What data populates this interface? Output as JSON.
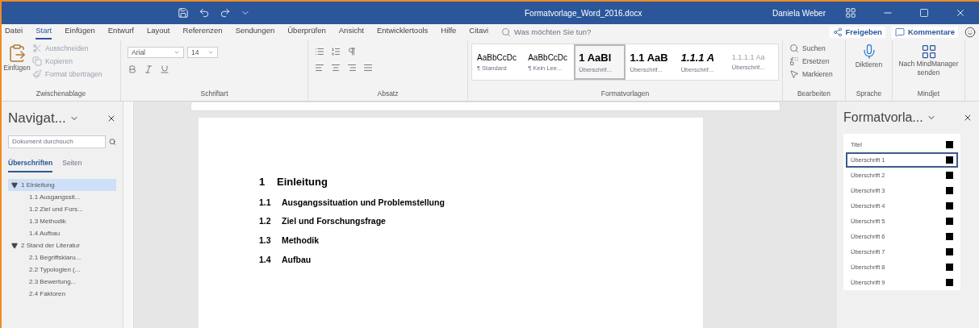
{
  "title_bar": {
    "document_title": "Formatvorlage_Word_2016.docx",
    "user_name": "Daniela Weber"
  },
  "ribbon": {
    "tabs": [
      {
        "label": "Datei",
        "selected": false
      },
      {
        "label": "Start",
        "selected": true
      },
      {
        "label": "Einfügen",
        "selected": false
      },
      {
        "label": "Entwurf",
        "selected": false
      },
      {
        "label": "Layout",
        "selected": false
      },
      {
        "label": "Referenzen",
        "selected": false
      },
      {
        "label": "Sendungen",
        "selected": false
      },
      {
        "label": "Überprüfen",
        "selected": false
      },
      {
        "label": "Ansicht",
        "selected": false
      },
      {
        "label": "Entwicklertools",
        "selected": false
      },
      {
        "label": "Hilfe",
        "selected": false
      },
      {
        "label": "Citavi",
        "selected": false
      }
    ],
    "tell_me": {
      "placeholder": "Was möchten Sie tun?"
    },
    "share": "Freigeben",
    "comments": "Kommentare",
    "clipboard": {
      "paste": "Einfügen",
      "items": [
        "Ausschneiden",
        "Kopieren",
        "Format übertragen"
      ],
      "label": "Zwischenablage"
    },
    "font": {
      "font_name": "Arial",
      "font_size": "14",
      "label": "Schriftart"
    },
    "paragraph": {
      "label": "Absatz"
    },
    "styles": {
      "items": [
        {
          "preview": "AaBbCcDc",
          "name": "¶ Standard",
          "kind": "normal",
          "selected": false
        },
        {
          "preview": "AaBbCcDc",
          "name": "¶ Kein Lee...",
          "kind": "normal",
          "selected": false
        },
        {
          "preview": "1 AaBl",
          "name": "Überschrif...",
          "kind": "heading",
          "selected": true
        },
        {
          "preview": "1.1 AaB",
          "name": "Überschrif...",
          "kind": "heading",
          "selected": false
        },
        {
          "preview": "1.1.1 A",
          "name": "Überschrif...",
          "kind": "italic",
          "selected": false
        },
        {
          "preview": "1.1.1.1 Aa",
          "name": "Überschrif...",
          "kind": "faint",
          "selected": false
        }
      ],
      "label": "Formatvorlagen"
    },
    "editing": {
      "items": [
        "Suchen",
        "Ersetzen",
        "Markieren"
      ],
      "label": "Bearbeiten"
    },
    "voice": {
      "button": "Diktieren",
      "label": "Sprache"
    },
    "addin": {
      "button": "Nach MindManager senden",
      "label": "Mindjet"
    }
  },
  "navigation": {
    "title": "Navigat...",
    "search": {
      "placeholder": "Dokument durchsuch"
    },
    "tabs": [
      {
        "label": "Überschriften",
        "selected": true
      },
      {
        "label": "Seiten",
        "selected": false
      }
    ],
    "headings": [
      {
        "text": "1 Einleitung",
        "expanded": true,
        "selected": true,
        "children": [
          {
            "text": "1.1 Ausgangssit..."
          },
          {
            "text": "1.2 Ziel und Fors..."
          },
          {
            "text": "1.3 Methodik"
          },
          {
            "text": "1.4 Aufbau"
          }
        ]
      },
      {
        "text": "2 Stand der Literatur",
        "expanded": true,
        "selected": false,
        "children": [
          {
            "text": "2.1 Begriffsklaru..."
          },
          {
            "text": "2.2 Typologien (..."
          },
          {
            "text": "2.3 Bewertung..."
          },
          {
            "text": "2.4 Faktoren"
          }
        ]
      }
    ]
  },
  "document": {
    "headings": [
      {
        "number": "1",
        "text": "Einleitung",
        "kind": "heading1"
      },
      {
        "number": "1.1",
        "text": "Ausgangssituation und Problemstellung",
        "kind": "heading2"
      },
      {
        "number": "1.2",
        "text": "Ziel und Forschungsfrage",
        "kind": "heading2"
      },
      {
        "number": "1.3",
        "text": "Methodik",
        "kind": "heading2"
      },
      {
        "number": "1.4",
        "text": "Aufbau",
        "kind": "heading2"
      }
    ]
  },
  "styles_pane": {
    "title": "Formatvorla...",
    "items": [
      {
        "name": "Titel",
        "selected": false
      },
      {
        "name": "Überschrift 1",
        "selected": true
      },
      {
        "name": "Überschrift 2",
        "selected": false
      },
      {
        "name": "Überschrift 3",
        "selected": false
      },
      {
        "name": "Überschrift 4",
        "selected": false
      },
      {
        "name": "Überschrift 5",
        "selected": false
      },
      {
        "name": "Überschrift 6",
        "selected": false
      },
      {
        "name": "Überschrift 7",
        "selected": false
      },
      {
        "name": "Überschrift 8",
        "selected": false
      },
      {
        "name": "Überschrift 9",
        "selected": false
      }
    ]
  }
}
